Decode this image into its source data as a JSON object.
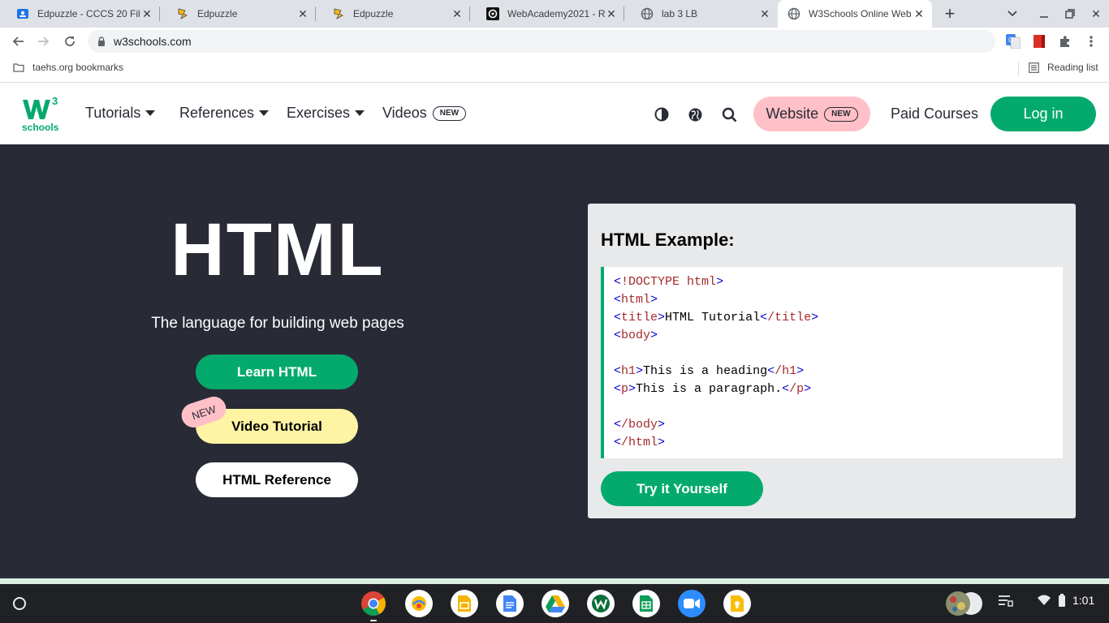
{
  "browser": {
    "tabs": [
      {
        "title": "Edpuzzle - CCCS 20 Fil",
        "icon": "google-classroom-icon"
      },
      {
        "title": "Edpuzzle",
        "icon": "edpuzzle-icon"
      },
      {
        "title": "Edpuzzle",
        "icon": "edpuzzle-icon"
      },
      {
        "title": "WebAcademy2021 - Re",
        "icon": "webacademy-icon"
      },
      {
        "title": "lab 3 LB",
        "icon": "globe-icon"
      },
      {
        "title": "W3Schools Online Web",
        "icon": "globe-icon"
      }
    ],
    "url": "w3schools.com",
    "bookmarks": [
      {
        "label": "taehs.org bookmarks",
        "icon": "folder-icon"
      },
      {
        "label": "Reading list",
        "icon": "reading-list-icon"
      }
    ]
  },
  "site": {
    "logo": {
      "top": "3",
      "main": "schools"
    },
    "nav": {
      "tutorials": "Tutorials",
      "references": "References",
      "exercises": "Exercises",
      "videos": "Videos",
      "new_badge": "NEW",
      "website": "Website",
      "paid_courses": "Paid Courses",
      "login": "Log in"
    },
    "hero": {
      "title": "HTML",
      "subtitle": "The language for building web pages",
      "learn_button": "Learn HTML",
      "video_button": "Video Tutorial",
      "video_new_tag": "NEW",
      "reference_button": "HTML Reference"
    },
    "example": {
      "heading": "HTML Example:",
      "try_button": "Try it Yourself"
    }
  },
  "shelf": {
    "time": "1:01",
    "apps": [
      "chrome-icon",
      "app-icon",
      "google-slides-icon",
      "google-docs-icon",
      "google-drive-icon",
      "app-icon",
      "google-sheets-icon",
      "zoom-icon",
      "google-keep-icon"
    ]
  },
  "colors": {
    "w3green": "#04aa6d",
    "hero_bg": "#282a35",
    "website_pink": "#ffc0c7",
    "video_yellow": "#fff4a3"
  }
}
